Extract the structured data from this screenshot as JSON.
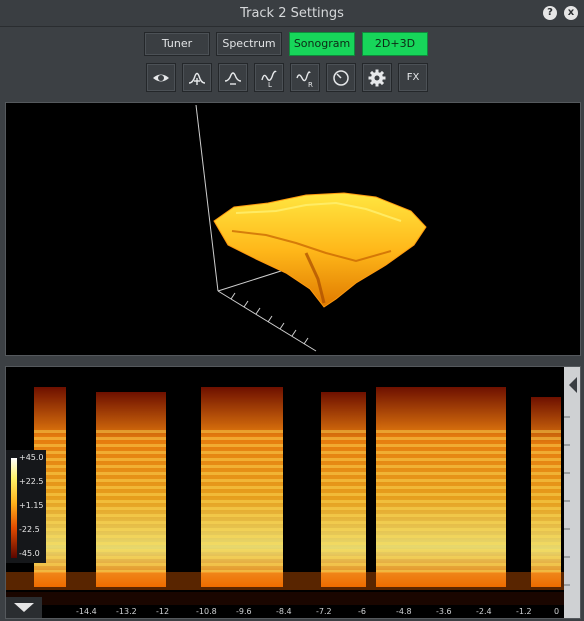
{
  "window": {
    "title": "Track 2 Settings",
    "help_glyph": "?",
    "close_glyph": "x"
  },
  "modes": [
    {
      "label": "Tuner",
      "active": false
    },
    {
      "label": "Spectrum",
      "active": false
    },
    {
      "label": "Sonogram",
      "active": true
    },
    {
      "label": "2D+3D",
      "active": true
    }
  ],
  "tools": [
    {
      "icon": "eye-icon"
    },
    {
      "icon": "peak-up-icon"
    },
    {
      "icon": "peak-down-icon"
    },
    {
      "icon": "wave-l-icon",
      "label": "L"
    },
    {
      "icon": "wave-r-icon",
      "label": "R"
    },
    {
      "icon": "gauge-icon"
    },
    {
      "icon": "gear-icon"
    },
    {
      "icon": "fx-icon",
      "label": "FX"
    }
  ],
  "colorbar": {
    "labels": [
      "+45.0",
      "+22.5",
      "+1.15",
      "-22.5",
      "-45.0"
    ]
  },
  "time_axis": {
    "ticks": [
      "-14.4",
      "-13.2",
      "-12",
      "-10.8",
      "-9.6",
      "-8.4",
      "-7.2",
      "-6",
      "-4.8",
      "-3.6",
      "-2.4",
      "-1.2",
      "0"
    ]
  },
  "colors": {
    "accent_green": "#17d65a",
    "panel_bg": "#3c4044"
  }
}
